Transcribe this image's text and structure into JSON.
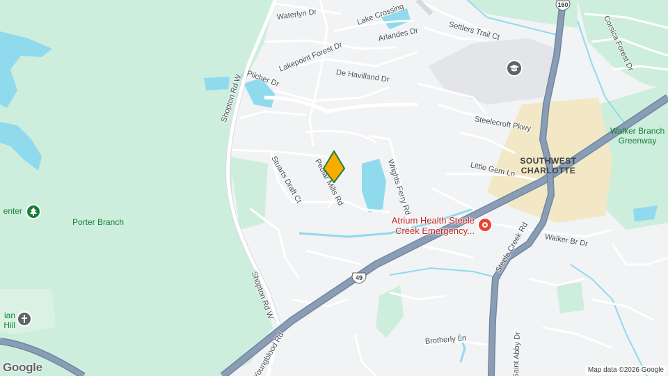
{
  "map": {
    "colors": {
      "land": "#f1f3f4",
      "park": "#cdeedc",
      "park_dark": "#bfe8cf",
      "water": "#90daee",
      "highway": "#8a9db5",
      "highway_edge": "#6f86a3",
      "road": "#ffffff",
      "road_edge": "#d6dadf",
      "commercial": "#f3e8c6",
      "campus": "#e3e5e8",
      "pin_fill": "#f9ab00",
      "pin_stroke": "#1e7f3a",
      "hospital": "#ea4335",
      "park_icon": "#188038"
    },
    "streets": {
      "waterlyn": "Waterlyn Dr",
      "lake_crossing": "Lake Crossing",
      "arlandes": "Arlandes Dr",
      "settlers_trail": "Settlers Trail Ct",
      "corsica_forest": "Corsica Forest Dr",
      "lakepoint_forest": "Lakepoint Forest Dr",
      "pilcher": "Pilcher Dr",
      "shopton_north": "Shopton Rd W",
      "de_havilland": "De Havilland Dr",
      "steelecroft": "Steelecroft Pkwy",
      "stuarts_draft": "Stuarts Draft Ct",
      "pedlar_mills": "Pedlar Mills Rd",
      "wrights_ferry": "Wrights Ferry Rd",
      "little_gem": "Little Gem Ln",
      "steele_creek": "Steele Creek Rd",
      "walker_br": "Walker Br Dr",
      "shopton_south": "Shopton Rd W",
      "brotherly": "Brotherly Ln",
      "youngblood": "Youngblood Rd",
      "saint_abby": "Saint Abby Dr"
    },
    "areas": {
      "southwest_charlotte": "SOUTHWEST\nCHARLOTTE",
      "walker_branch_greenway": "Walker Branch\nGreenway",
      "porter_branch": "Porter Branch",
      "center_partial": "enter",
      "hill_partial": "ian\nHill"
    },
    "pois": {
      "hospital": "Atrium Health Steele\nCreek Emergency..."
    },
    "shields": {
      "route_160": "160",
      "route_49": "49"
    },
    "icons": {
      "campus": "graduation-cap-icon",
      "park": "tree-icon",
      "church": "cross-icon",
      "hospital": "hospital-pin-icon",
      "selected": "location-pin-icon"
    },
    "logo": "Google",
    "attribution": "Map data ©2026 Google"
  }
}
